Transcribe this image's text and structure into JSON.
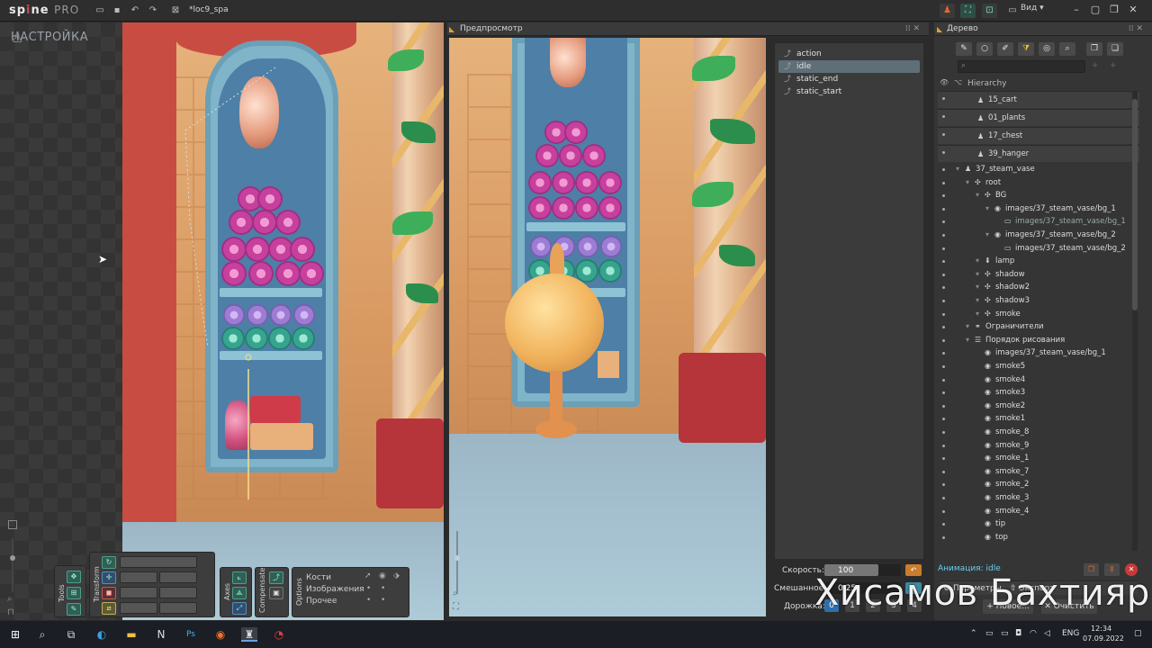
{
  "app": {
    "logo": "sp",
    "logo_mid": "ne",
    "logo_pro": "PRO",
    "file_title": "*loc9_spa",
    "view_label": "Вид"
  },
  "left": {
    "mode_label": "НАСТРОЙКА"
  },
  "preview": {
    "title": "Предпросмотр"
  },
  "animations": [
    {
      "name": "action",
      "selected": false
    },
    {
      "name": "idle",
      "selected": true
    },
    {
      "name": "static_end",
      "selected": false
    },
    {
      "name": "static_start",
      "selected": false
    }
  ],
  "tree": {
    "title": "Дерево",
    "section": "Hierarchy",
    "rows": [
      {
        "label": "15_cart",
        "level": 0,
        "group": true,
        "icon": "skeleton-icon"
      },
      {
        "label": "01_plants",
        "level": 0,
        "group": true,
        "icon": "skeleton-icon"
      },
      {
        "label": "17_chest",
        "level": 0,
        "group": true,
        "icon": "skeleton-icon"
      },
      {
        "label": "39_hanger",
        "level": 0,
        "group": true,
        "icon": "skeleton-icon"
      },
      {
        "label": "37_steam_vase",
        "level": 0,
        "group": false,
        "icon": "skeleton-icon"
      },
      {
        "label": "root",
        "level": 1,
        "group": false,
        "icon": "bone-icon"
      },
      {
        "label": "BG",
        "level": 2,
        "group": false,
        "icon": "bone-icon"
      },
      {
        "label": "images/37_steam_vase/bg_1",
        "level": 3,
        "group": false,
        "icon": "slot-icon"
      },
      {
        "label": "images/37_steam_vase/bg_1",
        "level": 4,
        "group": false,
        "icon": "image-icon",
        "dim": true
      },
      {
        "label": "images/37_steam_vase/bg_2",
        "level": 3,
        "group": false,
        "icon": "slot-icon"
      },
      {
        "label": "images/37_steam_vase/bg_2",
        "level": 4,
        "group": false,
        "icon": "image-icon"
      },
      {
        "label": "lamp",
        "level": 2,
        "group": false,
        "icon": "bone-down-icon"
      },
      {
        "label": "shadow",
        "level": 2,
        "group": false,
        "icon": "bone-icon"
      },
      {
        "label": "shadow2",
        "level": 2,
        "group": false,
        "icon": "bone-icon"
      },
      {
        "label": "shadow3",
        "level": 2,
        "group": false,
        "icon": "bone-icon"
      },
      {
        "label": "smoke",
        "level": 2,
        "group": false,
        "icon": "bone-icon"
      },
      {
        "label": "Ограничители",
        "level": 1,
        "group": false,
        "icon": "constraints-icon"
      },
      {
        "label": "Порядок рисования",
        "level": 1,
        "group": false,
        "icon": "draw-order-icon"
      },
      {
        "label": "images/37_steam_vase/bg_1",
        "level": 2,
        "group": false,
        "icon": "slot-icon"
      },
      {
        "label": "smoke5",
        "level": 2,
        "group": false,
        "icon": "slot-icon"
      },
      {
        "label": "smoke4",
        "level": 2,
        "group": false,
        "icon": "slot-icon"
      },
      {
        "label": "smoke3",
        "level": 2,
        "group": false,
        "icon": "slot-icon"
      },
      {
        "label": "smoke2",
        "level": 2,
        "group": false,
        "icon": "slot-icon"
      },
      {
        "label": "smoke1",
        "level": 2,
        "group": false,
        "icon": "slot-icon"
      },
      {
        "label": "smoke_8",
        "level": 2,
        "group": false,
        "icon": "slot-icon"
      },
      {
        "label": "smoke_9",
        "level": 2,
        "group": false,
        "icon": "slot-icon"
      },
      {
        "label": "smoke_1",
        "level": 2,
        "group": false,
        "icon": "slot-icon"
      },
      {
        "label": "smoke_7",
        "level": 2,
        "group": false,
        "icon": "slot-icon"
      },
      {
        "label": "smoke_2",
        "level": 2,
        "group": false,
        "icon": "slot-icon"
      },
      {
        "label": "smoke_3",
        "level": 2,
        "group": false,
        "icon": "slot-icon"
      },
      {
        "label": "smoke_4",
        "level": 2,
        "group": false,
        "icon": "slot-icon"
      },
      {
        "label": "tip",
        "level": 2,
        "group": false,
        "icon": "slot-icon"
      },
      {
        "label": "top",
        "level": 2,
        "group": false,
        "icon": "slot-icon"
      }
    ],
    "animation_label": "Анимация: idle",
    "params_label": "Параметры",
    "export_label": "Экспорт",
    "new_label": "Новое...",
    "clear_label": "Очистить"
  },
  "playback": {
    "speed_label": "Скорость:",
    "speed_value": "100",
    "mix_label": "Смешанное:",
    "mix_value": "0.25",
    "tracks_label": "Дорожка:",
    "tracks": [
      "0",
      "1",
      "2",
      "3",
      "4"
    ]
  },
  "tools": {
    "tools_label": "Tools",
    "transform_label": "Transform",
    "axes_label": "Axes",
    "compensate_label": "Compensate",
    "options_label": "Options",
    "options_rows": [
      "Кости",
      "Изображения",
      "Прочее"
    ]
  },
  "watermark": "Хисамов Бахтияр",
  "taskbar": {
    "lang": "ENG",
    "time": "12:34",
    "date": "07.09.2022"
  }
}
